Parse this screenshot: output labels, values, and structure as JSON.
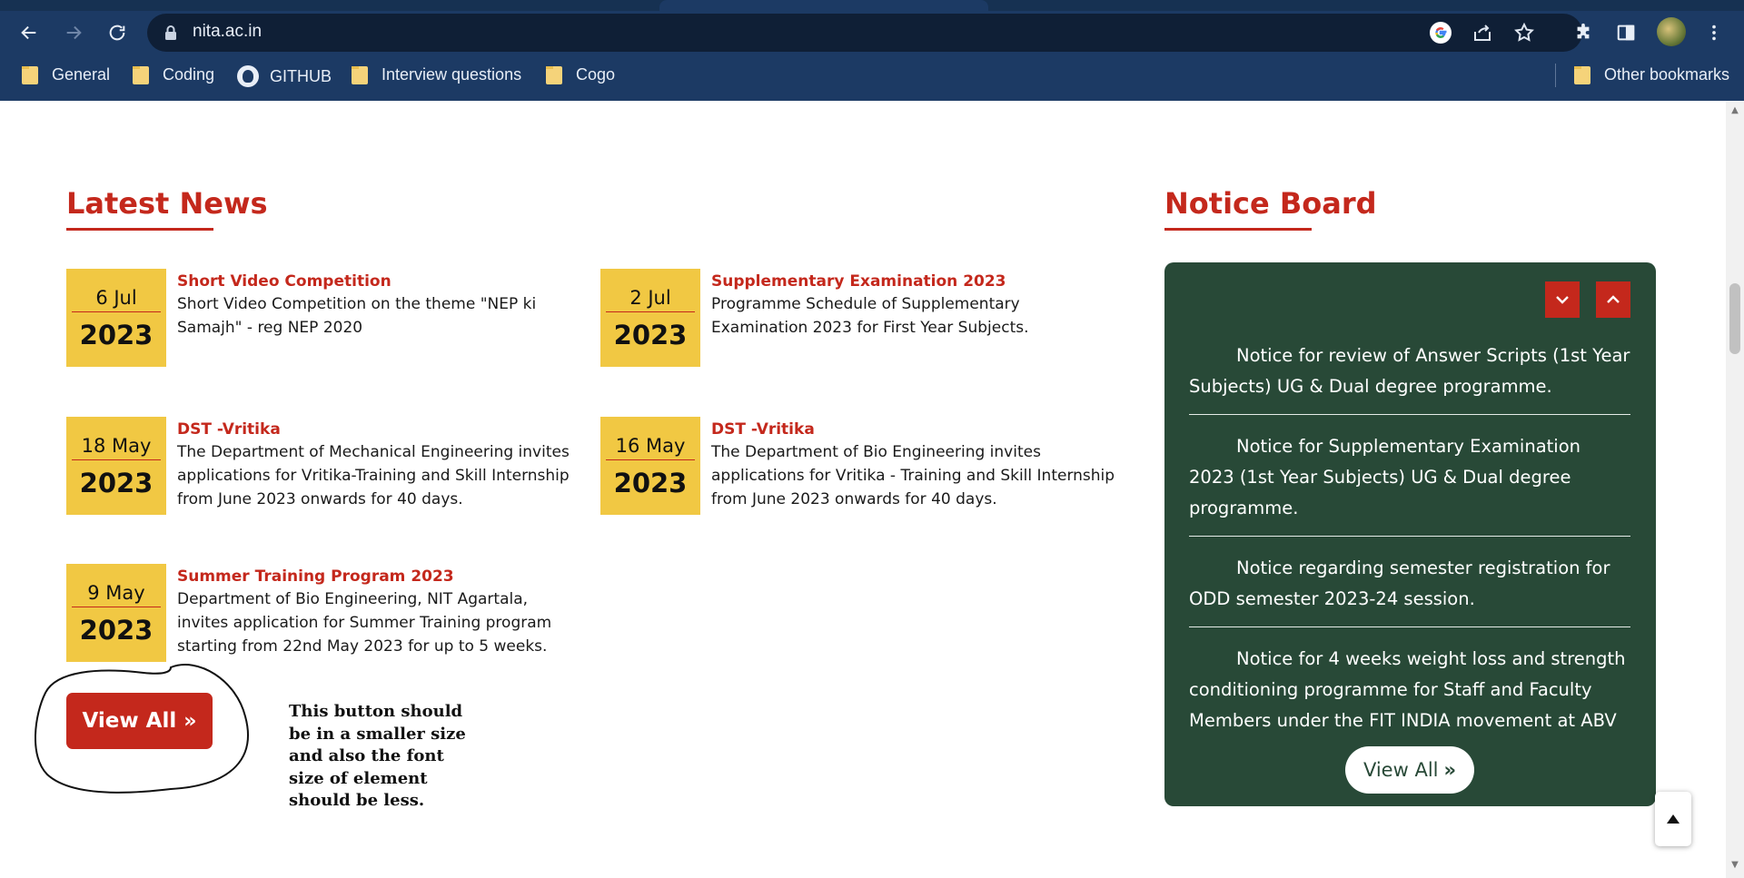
{
  "browser": {
    "url": "nita.ac.in",
    "bookmarks": [
      {
        "label": "General",
        "icon": "folder-icon"
      },
      {
        "label": "Coding",
        "icon": "folder-icon"
      },
      {
        "label": "GITHUB",
        "icon": "github-icon"
      },
      {
        "label": "Interview questions",
        "icon": "folder-icon"
      },
      {
        "label": "Cogo",
        "icon": "folder-icon"
      }
    ],
    "other_bookmarks": "Other bookmarks",
    "chrome_color": "#1c3a64"
  },
  "latest_news": {
    "title": "Latest News",
    "items": [
      {
        "day_month": "6 Jul",
        "year": "2023",
        "title": "Short Video Competition",
        "desc": "Short Video Competition on the theme \"NEP ki Samajh\" - reg NEP 2020"
      },
      {
        "day_month": "2 Jul",
        "year": "2023",
        "title": "Supplementary Examination 2023",
        "desc": "Programme Schedule of Supplementary Examination 2023 for First Year Subjects."
      },
      {
        "day_month": "18 May",
        "year": "2023",
        "title": "DST -Vritika",
        "desc": "The Department of  Mechanical Engineering invites applications for Vritika-Training and Skill Internship from June 2023 onwards for 40 days."
      },
      {
        "day_month": "16 May",
        "year": "2023",
        "title": "DST -Vritika",
        "desc": "The Department of Bio Engineering invites applications for Vritika - Training and Skill Internship from June 2023 onwards for 40 days."
      },
      {
        "day_month": "9 May",
        "year": "2023",
        "title": "Summer Training Program 2023",
        "desc": "Department of Bio Engineering, NIT Agartala, invites application for Summer Training program starting from 22nd May 2023 for up to 5 weeks."
      }
    ],
    "view_all": "View All",
    "accent_color": "#c4281c",
    "date_box_color": "#f1c843"
  },
  "annotation": {
    "text": "This button should be in a smaller size and also the font size of element should be less."
  },
  "notice_board": {
    "title": "Notice Board",
    "items": [
      "Notice for review of Answer Scripts (1st Year Subjects) UG & Dual degree programme.",
      "Notice for Supplementary Examination 2023 (1st Year Subjects) UG & Dual degree programme.",
      "Notice regarding semester registration for ODD semester 2023-24 session.",
      "Notice for 4 weeks weight loss and strength conditioning programme for Staff and Faculty Members under the FIT INDIA movement at ABV"
    ],
    "view_all": "View All",
    "panel_color": "#284937"
  }
}
